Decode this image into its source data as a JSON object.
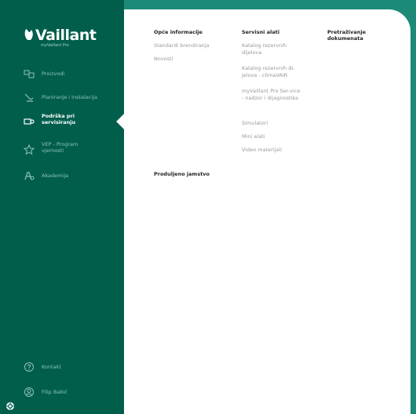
{
  "brand": {
    "name": "Vaillant",
    "subtitle": "myVaillant Pro"
  },
  "sidebar": {
    "items": [
      {
        "label": "Proizvodi",
        "icon": "product-icon"
      },
      {
        "label": "Planiranje i instalacija",
        "icon": "tools-icon"
      },
      {
        "label": "Podrška pri servisiranju",
        "icon": "service-icon"
      },
      {
        "label": "VEP - Program vjernosti",
        "icon": "star-icon"
      },
      {
        "label": "Akademija",
        "icon": "academy-icon"
      }
    ],
    "footer": [
      {
        "label": "Kontakt",
        "icon": "help-icon"
      },
      {
        "label": "Filip Babić",
        "icon": "user-icon"
      }
    ]
  },
  "menu": {
    "col1": {
      "heading": "Opće informacije",
      "links": [
        "Standardi brendiranja",
        "Novosti"
      ],
      "heading2": "Produljeno jamstvo"
    },
    "col2": {
      "heading": "Servisni alati",
      "links": [
        "Katalog rezervnih dijelova",
        "Katalog rezervnih di-jelova - climaVAIR",
        "myVaillant Pro Ser-vice - nadzor i dijagnostika",
        "Simulatori",
        "Mini alati",
        "Video materijali"
      ]
    },
    "col3": {
      "heading": "Pretraživanje dokumenata"
    }
  },
  "colors": {
    "sidebar_bg": "#005e4b",
    "frame_bg": "#1d8a78",
    "active_text": "#ffffff",
    "inactive_text": "#8fc4b8"
  }
}
